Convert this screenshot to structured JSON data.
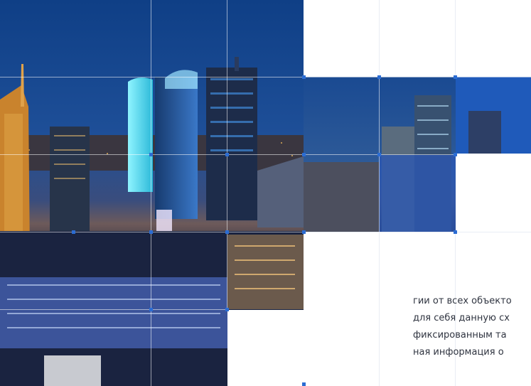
{
  "content": {
    "paragraph_lines": [
      "гии от всех объекто",
      "для себя данную сх",
      "фиксированным та",
      "ная информация о"
    ]
  },
  "image": {
    "subject": "city-skyline-night-icon"
  }
}
